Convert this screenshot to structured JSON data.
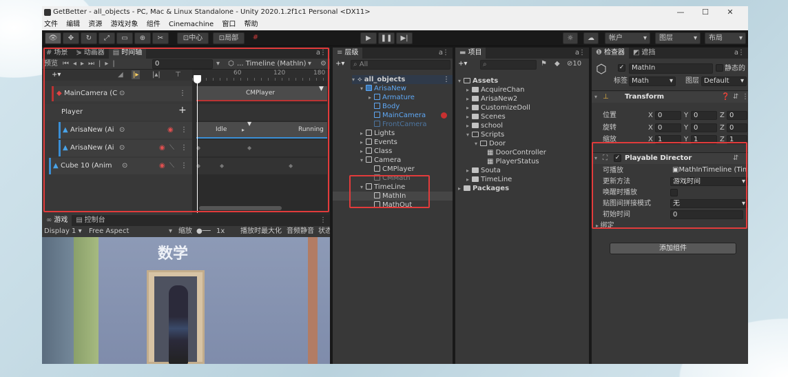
{
  "window": {
    "title": "GetBetter - all_objects - PC, Mac & Linux Standalone - Unity 2020.1.2f1c1 Personal <DX11>",
    "controls": [
      "—",
      "☐",
      "✕"
    ]
  },
  "menu": [
    "文件",
    "编辑",
    "资源",
    "游戏对象",
    "组件",
    "Cinemachine",
    "窗口",
    "帮助"
  ],
  "toolbar": {
    "pivot": "中心",
    "space": "局部",
    "account": "帐户",
    "layers": "图层",
    "layout": "布局"
  },
  "timeline": {
    "tabs": [
      "场景",
      "动画器",
      "时间轴"
    ],
    "preview": "预览",
    "frame": "0",
    "asset": "Timeline (MathIn)",
    "ruler": [
      "60",
      "120",
      "180"
    ],
    "tracks": [
      {
        "name": "MainCamera (C",
        "clip": "CMPlayer"
      },
      {
        "name": "Player"
      },
      {
        "name": "ArisaNew (Ai",
        "clip_a": "Idle",
        "clip_b": "Running"
      },
      {
        "name": "ArisaNew (Ai"
      },
      {
        "name": "Cube 10 (Anim"
      }
    ]
  },
  "game": {
    "tabs": [
      "游戏",
      "控制台"
    ],
    "display": "Display 1",
    "aspect": "Free Aspect",
    "scale_label": "缩放",
    "scale_value": "1x",
    "maximize": "播放时最大化",
    "mute": "音频静音",
    "stats": "状态",
    "sign": "数学"
  },
  "hierarchy": {
    "tab": "层级",
    "search": "All",
    "items": [
      {
        "text": "all_objects",
        "depth": 0
      },
      {
        "text": "ArisaNew",
        "depth": 1
      },
      {
        "text": "Armature",
        "depth": 2
      },
      {
        "text": "Body",
        "depth": 2
      },
      {
        "text": "MainCamera",
        "depth": 2
      },
      {
        "text": "FrontCamera",
        "depth": 2
      },
      {
        "text": "Lights",
        "depth": 1
      },
      {
        "text": "Events",
        "depth": 1
      },
      {
        "text": "Class",
        "depth": 1
      },
      {
        "text": "Camera",
        "depth": 1
      },
      {
        "text": "CMPlayer",
        "depth": 2
      },
      {
        "text": "CMMath",
        "depth": 2
      },
      {
        "text": "TimeLine",
        "depth": 1
      },
      {
        "text": "MathIn",
        "depth": 2
      },
      {
        "text": "MathOut",
        "depth": 2
      }
    ]
  },
  "project": {
    "tab": "项目",
    "count": "10",
    "items": [
      {
        "text": "Assets",
        "depth": 0
      },
      {
        "text": "AcquireChan",
        "depth": 1
      },
      {
        "text": "ArisaNew2",
        "depth": 1
      },
      {
        "text": "CustomizeDoll",
        "depth": 1
      },
      {
        "text": "Scenes",
        "depth": 1
      },
      {
        "text": "school",
        "depth": 1
      },
      {
        "text": "Scripts",
        "depth": 1
      },
      {
        "text": "Door",
        "depth": 2
      },
      {
        "text": "DoorController",
        "depth": 3
      },
      {
        "text": "PlayerStatus",
        "depth": 3
      },
      {
        "text": "Souta",
        "depth": 1
      },
      {
        "text": "TimeLine",
        "depth": 1
      },
      {
        "text": "Packages",
        "depth": 0
      }
    ]
  },
  "inspector": {
    "tabs": [
      "检查器",
      "遮挡"
    ],
    "object_name": "MathIn",
    "static": "静态的",
    "tag_label": "标签",
    "tag": "Math",
    "layer_label": "图层",
    "layer": "Default",
    "transform": {
      "title": "Transform",
      "rows": [
        {
          "label": "位置",
          "x": "0",
          "y": "0",
          "z": "0"
        },
        {
          "label": "旋转",
          "x": "0",
          "y": "0",
          "z": "0"
        },
        {
          "label": "缩放",
          "x": "1",
          "y": "1",
          "z": "1"
        }
      ]
    },
    "director": {
      "title": "Playable Director",
      "playable_label": "可播放",
      "playable": "MathInTimeline (Tin",
      "update_label": "更新方法",
      "update": "游戏时间",
      "awake_label": "唤醒时播放",
      "wrap_label": "贴图间拼接模式",
      "wrap": "无",
      "initial_label": "初始时间",
      "initial": "0",
      "bindings_label": "绑定"
    },
    "add_component": "添加组件"
  }
}
